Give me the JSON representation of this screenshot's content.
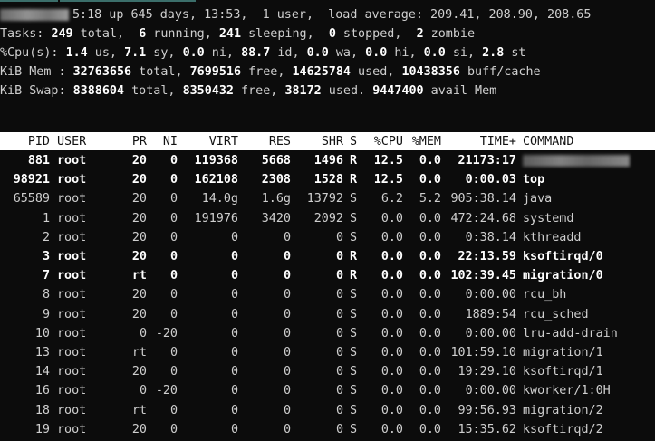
{
  "summary": {
    "hostname_redacted": "",
    "line1": "5:18 up 645 days, 13:53,  1 user,  load average: 209.41, 208.90, 208.65",
    "tasks": {
      "label": "Tasks:",
      "total": "249",
      "total_label": " total,  ",
      "running": "6",
      "running_label": " running, ",
      "sleeping": "241",
      "sleeping_label": " sleeping,  ",
      "stopped": "0",
      "stopped_label": " stopped,  ",
      "zombie": "2",
      "zombie_label": " zombie"
    },
    "cpu": {
      "label": "%Cpu(s): ",
      "us": "1.4",
      "us_label": " us, ",
      "sy": "7.1",
      "sy_label": " sy, ",
      "ni": "0.0",
      "ni_label": " ni, ",
      "id": "88.7",
      "id_label": " id, ",
      "wa": "0.0",
      "wa_label": " wa, ",
      "hi": "0.0",
      "hi_label": " hi, ",
      "si": "0.0",
      "si_label": " si, ",
      "st": "2.8",
      "st_label": " st"
    },
    "mem": {
      "label": "KiB Mem : ",
      "total": "32763656",
      "total_label": " total, ",
      "free": "7699516",
      "free_label": " free, ",
      "used": "14625784",
      "used_label": " used, ",
      "buff": "10438356",
      "buff_label": " buff/cache"
    },
    "swap": {
      "label": "KiB Swap: ",
      "total": "8388604",
      "total_label": " total, ",
      "free": "8350432",
      "free_label": " free, ",
      "used": "38172",
      "used_label": " used. ",
      "avail": "9447400",
      "avail_label": " avail Mem"
    }
  },
  "columns": [
    "PID",
    "USER",
    "PR",
    "NI",
    "VIRT",
    "RES",
    "SHR",
    "S",
    "%CPU",
    "%MEM",
    "TIME+",
    "COMMAND"
  ],
  "processes": [
    {
      "pid": "881",
      "user": "root",
      "pr": "20",
      "ni": "0",
      "virt": "119368",
      "res": "5668",
      "shr": "1496",
      "s": "R",
      "cpu": "12.5",
      "mem": "0.0",
      "time": "21173:17",
      "cmd": "",
      "redacted": true,
      "bold": true
    },
    {
      "pid": "98921",
      "user": "root",
      "pr": "20",
      "ni": "0",
      "virt": "162108",
      "res": "2308",
      "shr": "1528",
      "s": "R",
      "cpu": "12.5",
      "mem": "0.0",
      "time": "0:00.03",
      "cmd": "top",
      "bold": true
    },
    {
      "pid": "65589",
      "user": "root",
      "pr": "20",
      "ni": "0",
      "virt": "14.0g",
      "res": "1.6g",
      "shr": "13792",
      "s": "S",
      "cpu": "6.2",
      "mem": "5.2",
      "time": "905:38.14",
      "cmd": "java"
    },
    {
      "pid": "1",
      "user": "root",
      "pr": "20",
      "ni": "0",
      "virt": "191976",
      "res": "3420",
      "shr": "2092",
      "s": "S",
      "cpu": "0.0",
      "mem": "0.0",
      "time": "472:24.68",
      "cmd": "systemd"
    },
    {
      "pid": "2",
      "user": "root",
      "pr": "20",
      "ni": "0",
      "virt": "0",
      "res": "0",
      "shr": "0",
      "s": "S",
      "cpu": "0.0",
      "mem": "0.0",
      "time": "0:38.14",
      "cmd": "kthreadd"
    },
    {
      "pid": "3",
      "user": "root",
      "pr": "20",
      "ni": "0",
      "virt": "0",
      "res": "0",
      "shr": "0",
      "s": "R",
      "cpu": "0.0",
      "mem": "0.0",
      "time": "22:13.59",
      "cmd": "ksoftirqd/0",
      "bold": true
    },
    {
      "pid": "7",
      "user": "root",
      "pr": "rt",
      "ni": "0",
      "virt": "0",
      "res": "0",
      "shr": "0",
      "s": "R",
      "cpu": "0.0",
      "mem": "0.0",
      "time": "102:39.45",
      "cmd": "migration/0",
      "bold": true
    },
    {
      "pid": "8",
      "user": "root",
      "pr": "20",
      "ni": "0",
      "virt": "0",
      "res": "0",
      "shr": "0",
      "s": "S",
      "cpu": "0.0",
      "mem": "0.0",
      "time": "0:00.00",
      "cmd": "rcu_bh"
    },
    {
      "pid": "9",
      "user": "root",
      "pr": "20",
      "ni": "0",
      "virt": "0",
      "res": "0",
      "shr": "0",
      "s": "S",
      "cpu": "0.0",
      "mem": "0.0",
      "time": "1889:54",
      "cmd": "rcu_sched"
    },
    {
      "pid": "10",
      "user": "root",
      "pr": "0",
      "ni": "-20",
      "virt": "0",
      "res": "0",
      "shr": "0",
      "s": "S",
      "cpu": "0.0",
      "mem": "0.0",
      "time": "0:00.00",
      "cmd": "lru-add-drain"
    },
    {
      "pid": "13",
      "user": "root",
      "pr": "rt",
      "ni": "0",
      "virt": "0",
      "res": "0",
      "shr": "0",
      "s": "S",
      "cpu": "0.0",
      "mem": "0.0",
      "time": "101:59.10",
      "cmd": "migration/1"
    },
    {
      "pid": "14",
      "user": "root",
      "pr": "20",
      "ni": "0",
      "virt": "0",
      "res": "0",
      "shr": "0",
      "s": "S",
      "cpu": "0.0",
      "mem": "0.0",
      "time": "19:29.10",
      "cmd": "ksoftirqd/1"
    },
    {
      "pid": "16",
      "user": "root",
      "pr": "0",
      "ni": "-20",
      "virt": "0",
      "res": "0",
      "shr": "0",
      "s": "S",
      "cpu": "0.0",
      "mem": "0.0",
      "time": "0:00.00",
      "cmd": "kworker/1:0H"
    },
    {
      "pid": "18",
      "user": "root",
      "pr": "rt",
      "ni": "0",
      "virt": "0",
      "res": "0",
      "shr": "0",
      "s": "S",
      "cpu": "0.0",
      "mem": "0.0",
      "time": "99:56.93",
      "cmd": "migration/2"
    },
    {
      "pid": "19",
      "user": "root",
      "pr": "20",
      "ni": "0",
      "virt": "0",
      "res": "0",
      "shr": "0",
      "s": "S",
      "cpu": "0.0",
      "mem": "0.0",
      "time": "15:35.62",
      "cmd": "ksoftirqd/2"
    }
  ]
}
